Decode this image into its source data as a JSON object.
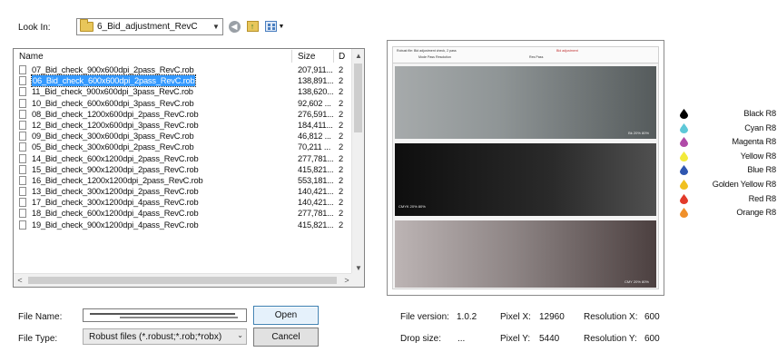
{
  "look_in": {
    "label": "Look In:",
    "folder": "6_Bid_adjustment_RevC"
  },
  "toolbar": {
    "back_glyph": "◀",
    "up_glyph": "↑",
    "views_drop_glyph": "▼"
  },
  "file_list": {
    "headers": {
      "name": "Name",
      "size": "Size",
      "date": "D"
    },
    "rows": [
      {
        "name": "07_Bid_check_900x600dpi_2pass_RevC.rob",
        "size": "207,911...",
        "date": "2"
      },
      {
        "name": "06_Bid_check_600x600dpi_2pass_RevC.rob",
        "size": "138,891...",
        "date": "2",
        "selected": true
      },
      {
        "name": "11_Bid_check_900x600dpi_3pass_RevC.rob",
        "size": "138,620...",
        "date": "2"
      },
      {
        "name": "10_Bid_check_600x600dpi_3pass_RevC.rob",
        "size": "92,602 ...",
        "date": "2"
      },
      {
        "name": "08_Bid_check_1200x600dpi_2pass_RevC.rob",
        "size": "276,591...",
        "date": "2"
      },
      {
        "name": "12_Bid_check_1200x600dpi_3pass_RevC.rob",
        "size": "184,411...",
        "date": "2"
      },
      {
        "name": "09_Bid_check_300x600dpi_3pass_RevC.rob",
        "size": "46,812 ...",
        "date": "2"
      },
      {
        "name": "05_Bid_check_300x600dpi_2pass_RevC.rob",
        "size": "70,211 ...",
        "date": "2"
      },
      {
        "name": "14_Bid_check_600x1200dpi_2pass_RevC.rob",
        "size": "277,781...",
        "date": "2"
      },
      {
        "name": "15_Bid_check_900x1200dpi_2pass_RevC.rob",
        "size": "415,821...",
        "date": "2"
      },
      {
        "name": "16_Bid_check_1200x1200dpi_2pass_RevC.rob",
        "size": "553,181...",
        "date": "2"
      },
      {
        "name": "13_Bid_check_300x1200dpi_2pass_RevC.rob",
        "size": "140,421...",
        "date": "2"
      },
      {
        "name": "17_Bid_check_300x1200dpi_4pass_RevC.rob",
        "size": "140,421...",
        "date": "2"
      },
      {
        "name": "18_Bid_check_600x1200dpi_4pass_RevC.rob",
        "size": "277,781...",
        "date": "2"
      },
      {
        "name": "19_Bid_check_900x1200dpi_4pass_RevC.rob",
        "size": "415,821...",
        "date": "2"
      }
    ],
    "scroll": {
      "up": "▲",
      "down": "▼",
      "left": "<",
      "right": ">"
    }
  },
  "preview": {
    "header_line1": "Robust file: Bid adjustment check, 2 pass",
    "header_line2": "Mode  Pass  Resolution",
    "header_line3": "Bid adjustment",
    "header_line4": "Res  Pass",
    "band_labels": [
      "Bk 20% 80%",
      "CMYK 20% 80%",
      "CMY 20% 80%"
    ]
  },
  "inks": [
    {
      "label": "Black R8",
      "color": "#000000"
    },
    {
      "label": "Cyan R8",
      "color": "#5ec8d8"
    },
    {
      "label": "Magenta R8",
      "color": "#b04aa8"
    },
    {
      "label": "Yellow R8",
      "color": "#f2ea3a"
    },
    {
      "label": "Blue R8",
      "color": "#2f56b0"
    },
    {
      "label": "Golden Yellow R8",
      "color": "#f0c020"
    },
    {
      "label": "Red R8",
      "color": "#e23a2a"
    },
    {
      "label": "Orange R8",
      "color": "#f0902a"
    }
  ],
  "bottom": {
    "file_name_label": "File Name:",
    "file_type_label": "File Type:",
    "file_type_value": "Robust files (*.robust;*.rob;*robx)",
    "open_label": "Open",
    "cancel_label": "Cancel",
    "file_version_label": "File version:",
    "file_version_value": "1.0.2",
    "drop_size_label": "Drop size:",
    "drop_size_value": "...",
    "pixel_x_label": "Pixel X:",
    "pixel_x_value": "12960",
    "pixel_y_label": "Pixel Y:",
    "pixel_y_value": "5440",
    "res_x_label": "Resolution X:",
    "res_x_value": "600",
    "res_y_label": "Resolution Y:",
    "res_y_value": "600"
  }
}
